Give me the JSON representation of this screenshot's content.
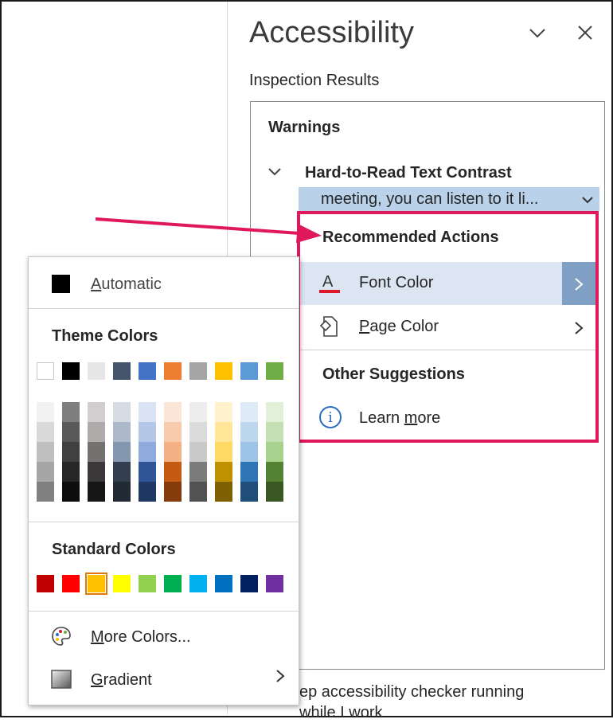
{
  "pane": {
    "title": "Accessibility",
    "dropdown_icon": "chevron-down-icon",
    "close_icon": "close-icon",
    "inspection_label": "Inspection Results",
    "warnings_label": "Warnings",
    "issue_title": "Hard-to-Read Text Contrast",
    "issue_detail": "meeting, you can listen to it li...",
    "footer_text_line1": "ep accessibility checker running",
    "footer_text_line2": "while I work"
  },
  "recommended": {
    "heading": "Recommended Actions",
    "font_color_label": "Font Color",
    "page_color_prefix": "",
    "page_color_label": "Page Color",
    "other_heading": "Other Suggestions",
    "learn_more_label": "Learn more"
  },
  "color_picker": {
    "automatic_label": "Automatic",
    "theme_heading": "Theme Colors",
    "standard_heading": "Standard Colors",
    "more_colors_label": "More Colors...",
    "gradient_label": "Gradient",
    "theme_colors": [
      "#ffffff",
      "#000000",
      "#e7e6e6",
      "#44546a",
      "#4472c4",
      "#ed7d31",
      "#a5a5a5",
      "#ffc000",
      "#5b9bd5",
      "#70ad47"
    ],
    "theme_tints": [
      [
        "#f2f2f2",
        "#d9d9d9",
        "#bfbfbf",
        "#a6a6a6",
        "#808080"
      ],
      [
        "#7f7f7f",
        "#595959",
        "#404040",
        "#262626",
        "#0d0d0d"
      ],
      [
        "#d0cece",
        "#aeabab",
        "#757171",
        "#3a3838",
        "#171616"
      ],
      [
        "#d6dce4",
        "#adb9ca",
        "#8497b0",
        "#333f50",
        "#222a35"
      ],
      [
        "#dae3f3",
        "#b4c7e7",
        "#8faadc",
        "#2f5597",
        "#1f3864"
      ],
      [
        "#fbe5d6",
        "#f8cbad",
        "#f4b183",
        "#c55a11",
        "#843c0c"
      ],
      [
        "#ededed",
        "#dbdbdb",
        "#c9c9c9",
        "#7b7b7b",
        "#525252"
      ],
      [
        "#fff2cc",
        "#ffe699",
        "#ffd966",
        "#bf9000",
        "#7f6000"
      ],
      [
        "#deebf7",
        "#bdd7ee",
        "#9dc3e6",
        "#2e75b6",
        "#1f4e79"
      ],
      [
        "#e2f0d9",
        "#c5e0b4",
        "#a9d18e",
        "#548235",
        "#385723"
      ]
    ],
    "standard_colors": [
      "#c00000",
      "#ff0000",
      "#ffc000",
      "#ffff00",
      "#92d050",
      "#00b050",
      "#00b0f0",
      "#0070c0",
      "#002060",
      "#7030a0"
    ],
    "selected_standard_index": 2
  },
  "accent": {
    "highlight_border": "#e0185b",
    "arrow_color": "#e0185b",
    "selection_blue": "#b9d1e9"
  }
}
